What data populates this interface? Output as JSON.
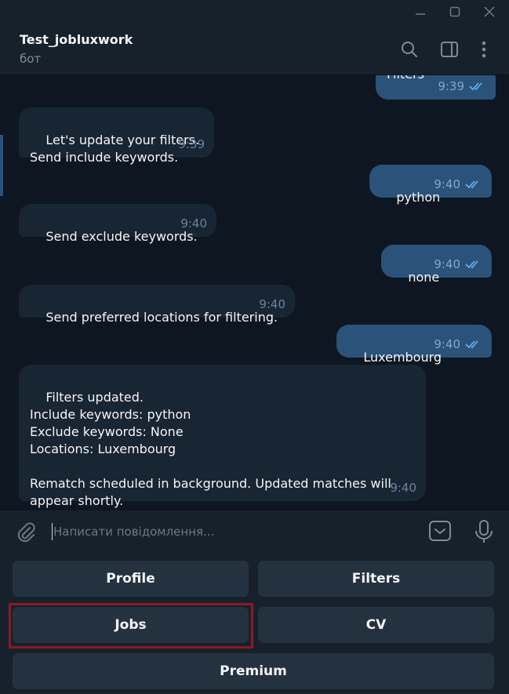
{
  "window": {
    "controls": [
      "minimize-icon",
      "maximize-icon",
      "close-icon"
    ]
  },
  "header": {
    "title": "Test_jobluxwork",
    "subtitle": "бот",
    "icons": [
      "search-icon",
      "side-panel-icon",
      "more-vertical-icon"
    ]
  },
  "messages": [
    {
      "direction": "out",
      "text": "Filters",
      "time": "9:39",
      "read": true
    },
    {
      "direction": "in",
      "text": "Let's update your filters.\nSend include keywords.",
      "time": "9:39"
    },
    {
      "direction": "out",
      "text": "python",
      "time": "9:40",
      "read": true
    },
    {
      "direction": "in",
      "text": "Send exclude keywords.",
      "time": "9:40"
    },
    {
      "direction": "out",
      "text": "none",
      "time": "9:40",
      "read": true
    },
    {
      "direction": "in",
      "text": "Send preferred locations for filtering.",
      "time": "9:40"
    },
    {
      "direction": "out",
      "text": "Luxembourg",
      "time": "9:40",
      "read": true
    },
    {
      "direction": "in",
      "text": "Filters updated.\nInclude keywords: python\nExclude keywords: None\nLocations: Luxembourg\n\nRematch scheduled in background. Updated matches will appear shortly.",
      "time": "9:40"
    }
  ],
  "input": {
    "placeholder": "Написати повідомлення..."
  },
  "keyboard": {
    "buttons": [
      "Profile",
      "Filters",
      "Jobs",
      "CV",
      "Premium"
    ],
    "highlighted": "Jobs"
  },
  "colors": {
    "background": "#0e1621",
    "panel": "#17212b",
    "incoming_bubble": "#182533",
    "outgoing_bubble": "#2b5278",
    "keyboard_button": "#243240",
    "highlight": "#8c1a24",
    "read_check": "#5eb5f7"
  }
}
